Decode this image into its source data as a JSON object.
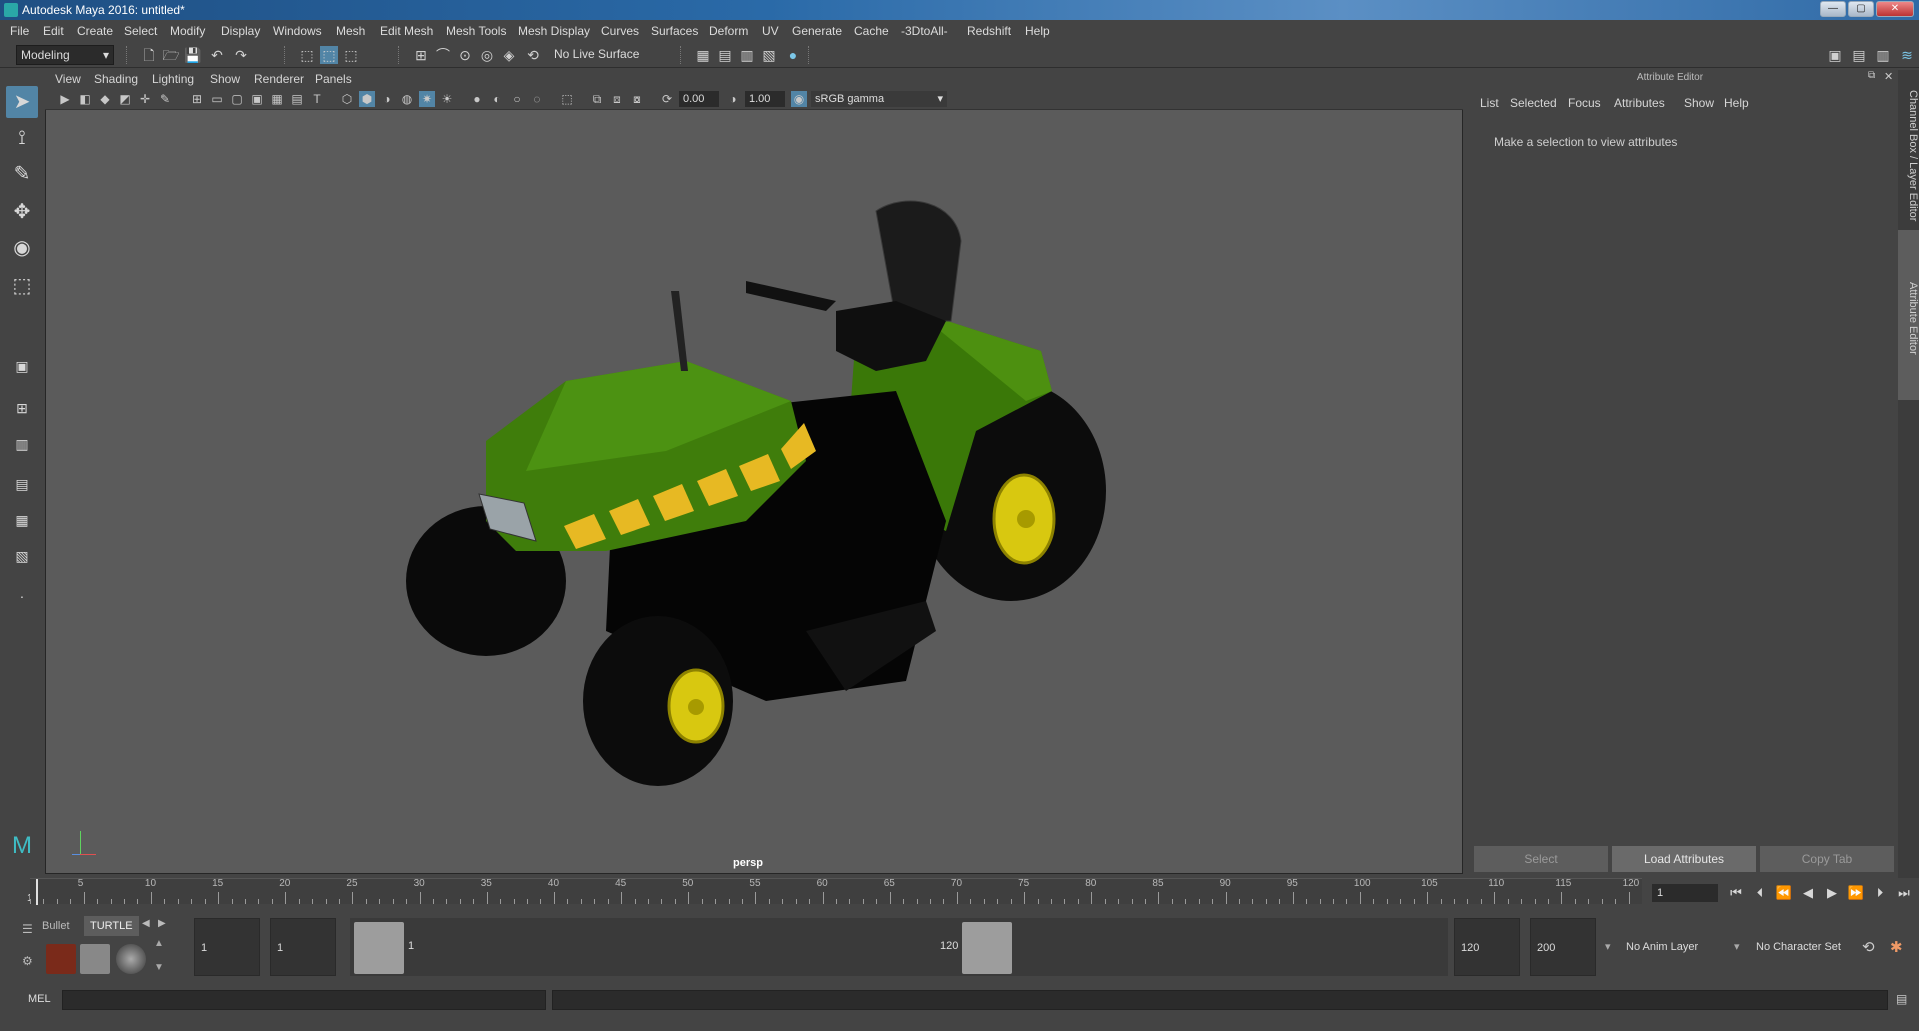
{
  "window": {
    "title": "Autodesk Maya 2016: untitled*",
    "buttons": [
      "—",
      "▢",
      "✕"
    ]
  },
  "menubar": [
    "File",
    "Edit",
    "Create",
    "Select",
    "Modify",
    "Display",
    "Windows",
    "Mesh",
    "Edit Mesh",
    "Mesh Tools",
    "Mesh Display",
    "Curves",
    "Surfaces",
    "Deform",
    "UV",
    "Generate",
    "Cache",
    "-3DtoAll-",
    "Redshift",
    "Help"
  ],
  "statusbar": {
    "mode": "Modeling",
    "live_surface": "No Live Surface"
  },
  "viewport": {
    "menus": [
      "View",
      "Shading",
      "Lighting",
      "Show",
      "Renderer",
      "Panels"
    ],
    "exposure": "0.00",
    "gamma": "1.00",
    "color_space": "sRGB gamma",
    "camera_label": "persp"
  },
  "attribute_editor": {
    "title": "Attribute Editor",
    "menus": [
      "List",
      "Selected",
      "Focus",
      "Attributes",
      "Show",
      "Help"
    ],
    "message": "Make a selection to view attributes",
    "buttons": {
      "select": "Select",
      "load": "Load Attributes",
      "copy": "Copy Tab"
    }
  },
  "side_tabs": {
    "channel_box": "Channel Box / Layer Editor",
    "attribute_editor": "Attribute Editor"
  },
  "timeline": {
    "start_label": "1",
    "ticks": [
      "5",
      "10",
      "15",
      "20",
      "25",
      "30",
      "35",
      "40",
      "45",
      "50",
      "55",
      "60",
      "65",
      "70",
      "75",
      "80",
      "85",
      "90",
      "95",
      "100",
      "105",
      "110",
      "115",
      "120"
    ],
    "current_frame": "1"
  },
  "shelf": {
    "tabs": [
      "Bullet",
      "TURTLE"
    ]
  },
  "range": {
    "start": "1",
    "playback_start": "1",
    "handle_start": "1",
    "handle_end": "120",
    "playback_end": "120",
    "end": "200",
    "anim_layer": "No Anim Layer",
    "character_set": "No Character Set"
  },
  "command_line": {
    "label": "MEL"
  },
  "colors": {
    "tractor_body": "#3f7d0b",
    "wheel_rim": "#e0d016",
    "viewport_bg": "#5b5b5b",
    "active_tool": "#5285a6"
  }
}
